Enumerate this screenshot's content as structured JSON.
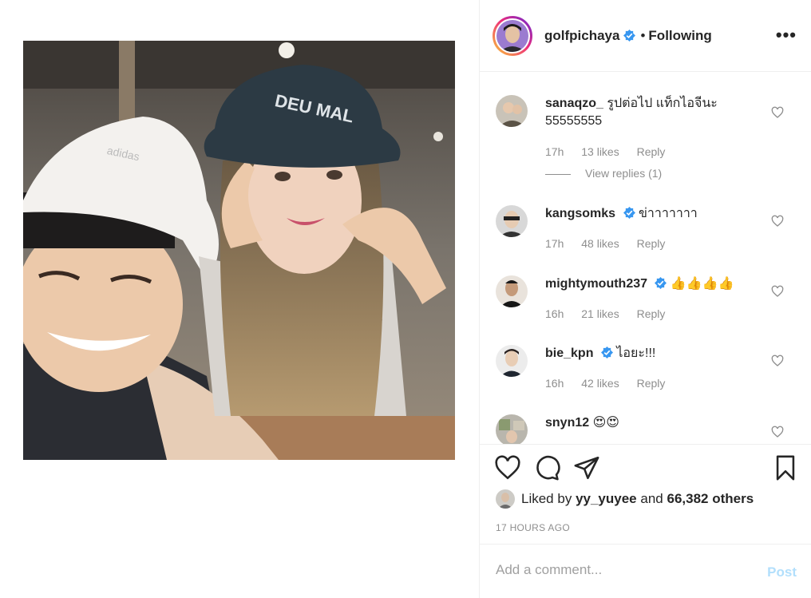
{
  "post": {
    "author": "golfpichaya",
    "separator": "•",
    "follow_status": "Following",
    "more_icon": "more-horizontal-icon",
    "verified_color": "#3897f0"
  },
  "comments": [
    {
      "user": "sanaqzo_",
      "text": "รูปต่อไป แท็กไอจีนะ 55555555",
      "verified": false,
      "time": "17h",
      "likes": "13 likes",
      "reply": "Reply",
      "view_replies": "View replies (1)"
    },
    {
      "user": "kangsomks",
      "text": "ข่าาาาาาา",
      "verified": true,
      "time": "17h",
      "likes": "48 likes",
      "reply": "Reply"
    },
    {
      "user": "mightymouth237",
      "text": "👍👍👍👍",
      "verified": true,
      "time": "16h",
      "likes": "21 likes",
      "reply": "Reply"
    },
    {
      "user": "bie_kpn",
      "text": "ไอยะ!!!",
      "verified": true,
      "time": "16h",
      "likes": "42 likes",
      "reply": "Reply"
    },
    {
      "user": "snyn12",
      "text": "😍😍",
      "verified": false
    }
  ],
  "actions": {
    "like_icon": "heart-icon",
    "comment_icon": "comment-icon",
    "share_icon": "share-icon",
    "save_icon": "bookmark-icon"
  },
  "likes": {
    "prefix": "Liked by",
    "user": "yy_yuyee",
    "and": "and",
    "others": "66,382 others"
  },
  "timestamp": "17 HOURS AGO",
  "add_comment": {
    "placeholder": "Add a comment...",
    "post_label": "Post"
  }
}
